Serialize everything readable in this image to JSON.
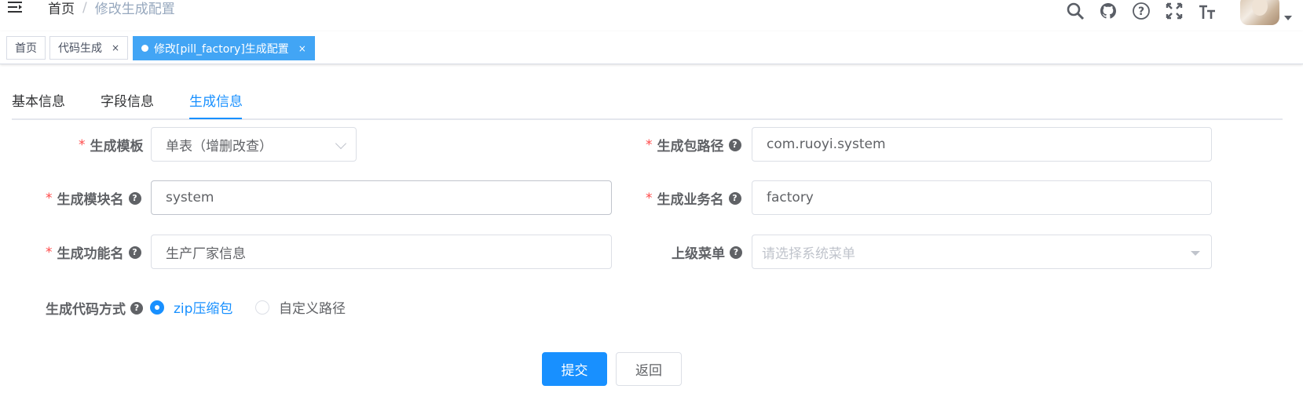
{
  "breadcrumb": {
    "home": "首页",
    "separator": "/",
    "current": "修改生成配置"
  },
  "navbar_icons": [
    "search-icon",
    "github-icon",
    "question-circle-icon",
    "fullscreen-icon",
    "font-size-icon"
  ],
  "tags": [
    {
      "label": "首页",
      "closable": false,
      "active": false
    },
    {
      "label": "代码生成",
      "closable": true,
      "active": false
    },
    {
      "label": "修改[pill_factory]生成配置",
      "closable": true,
      "active": true
    }
  ],
  "tag_close_symbol": "×",
  "tabs": [
    "基本信息",
    "字段信息",
    "生成信息"
  ],
  "active_tab": "生成信息",
  "form": {
    "required_mark": "*",
    "help_symbol": "?",
    "template": {
      "label": "生成模板",
      "value": "单表（增删改查）"
    },
    "package_path": {
      "label": "生成包路径",
      "value": "com.ruoyi.system"
    },
    "module_name": {
      "label": "生成模块名",
      "value": "system"
    },
    "business_name": {
      "label": "生成业务名",
      "value": "factory"
    },
    "function_name": {
      "label": "生成功能名",
      "value": "生产厂家信息"
    },
    "parent_menu": {
      "label": "上级菜单",
      "placeholder": "请选择系统菜单"
    },
    "gen_type": {
      "label": "生成代码方式",
      "options": [
        "zip压缩包",
        "自定义路径"
      ],
      "selected": "zip压缩包"
    }
  },
  "buttons": {
    "submit": "提交",
    "back": "返回"
  },
  "colors": {
    "primary": "#1890ff",
    "tag_active": "#42a5f5",
    "required": "#ff4949"
  }
}
